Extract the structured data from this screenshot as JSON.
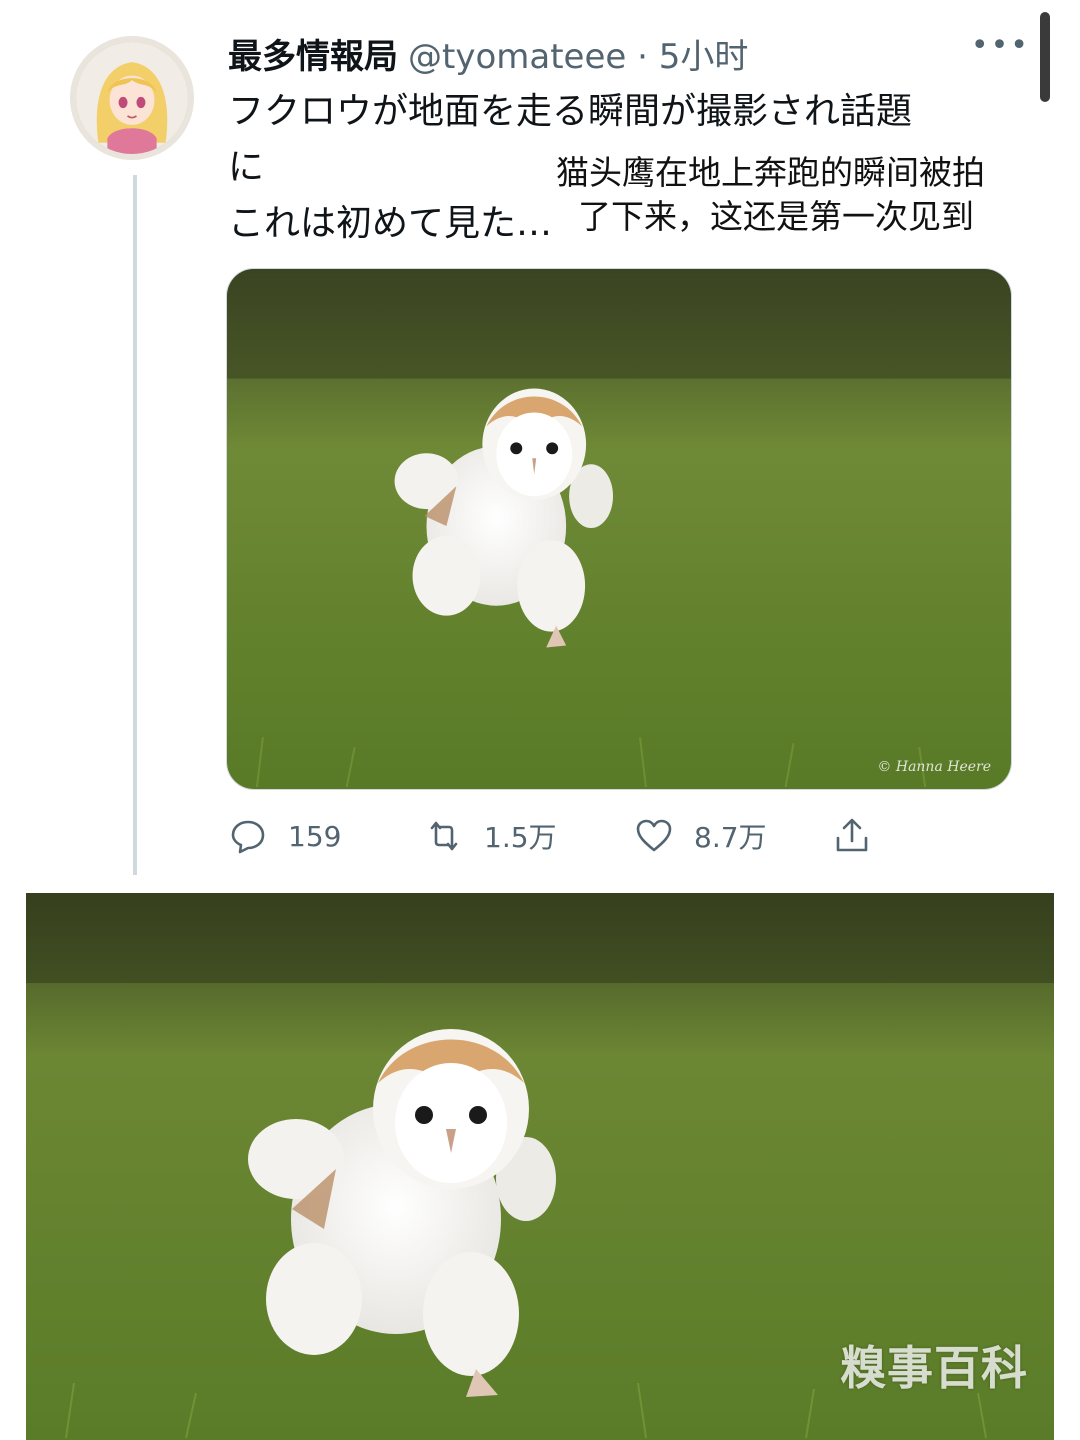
{
  "tweet": {
    "display_name": "最多情報局",
    "handle_time": "@tyomateee · 5小时",
    "more_icon": "more-dots-icon",
    "text_lines": [
      "フクロウが地面を走る瞬間が撮影され話題",
      "に",
      "これは初めて見た…"
    ],
    "translation_lines": [
      "猫头鹰在地上奔跑的瞬间被拍",
      "了下来，这还是第一次见到"
    ],
    "media": {
      "credit": "© Hanna Heere"
    },
    "actions": {
      "reply_icon": "reply-bubble-icon",
      "reply_count": "159",
      "retweet_icon": "retweet-icon",
      "retweet_count": "1.5万",
      "like_icon": "heart-icon",
      "like_count": "8.7万",
      "share_icon": "share-icon"
    }
  },
  "photo": {
    "watermark": "糗事百科"
  },
  "colors": {
    "text_primary": "#0f1419",
    "text_secondary": "#536471",
    "divider": "#cfd9de",
    "grass": "#5e7a2c"
  }
}
